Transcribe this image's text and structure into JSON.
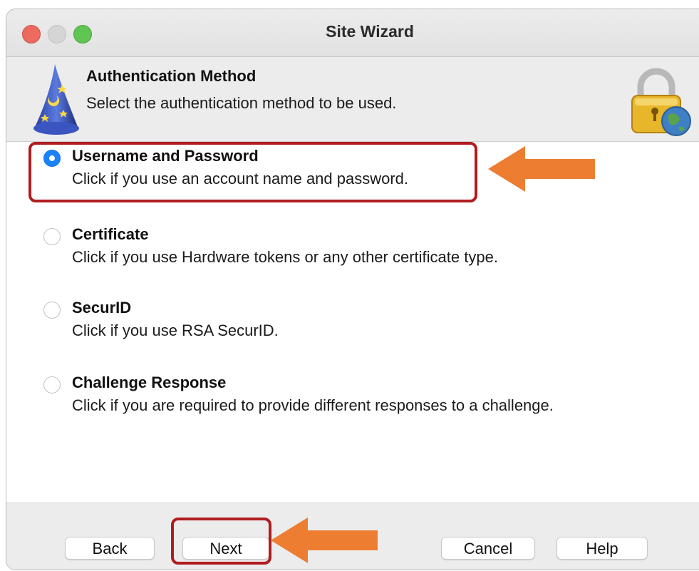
{
  "window": {
    "title": "Site Wizard"
  },
  "header": {
    "title": "Authentication Method",
    "subtitle": "Select the authentication method to be used.",
    "left_icon": "wizard-hat-icon",
    "right_icon": "lock-globe-icon"
  },
  "options": [
    {
      "title": "Username and Password",
      "description": "Click if you use an account name and password.",
      "selected": true
    },
    {
      "title": "Certificate",
      "description": "Click if you use Hardware tokens or any other certificate type.",
      "selected": false
    },
    {
      "title": "SecurID",
      "description": "Click if you use RSA SecurID.",
      "selected": false
    },
    {
      "title": "Challenge Response",
      "description": "Click if you are required to provide different responses to a challenge.",
      "selected": false
    }
  ],
  "buttons": {
    "back": "Back",
    "next": "Next",
    "cancel": "Cancel",
    "help": "Help"
  },
  "colors": {
    "accent": "#1a82fb",
    "highlight_box": "#b01c1f",
    "arrow": "#ed7d31"
  }
}
